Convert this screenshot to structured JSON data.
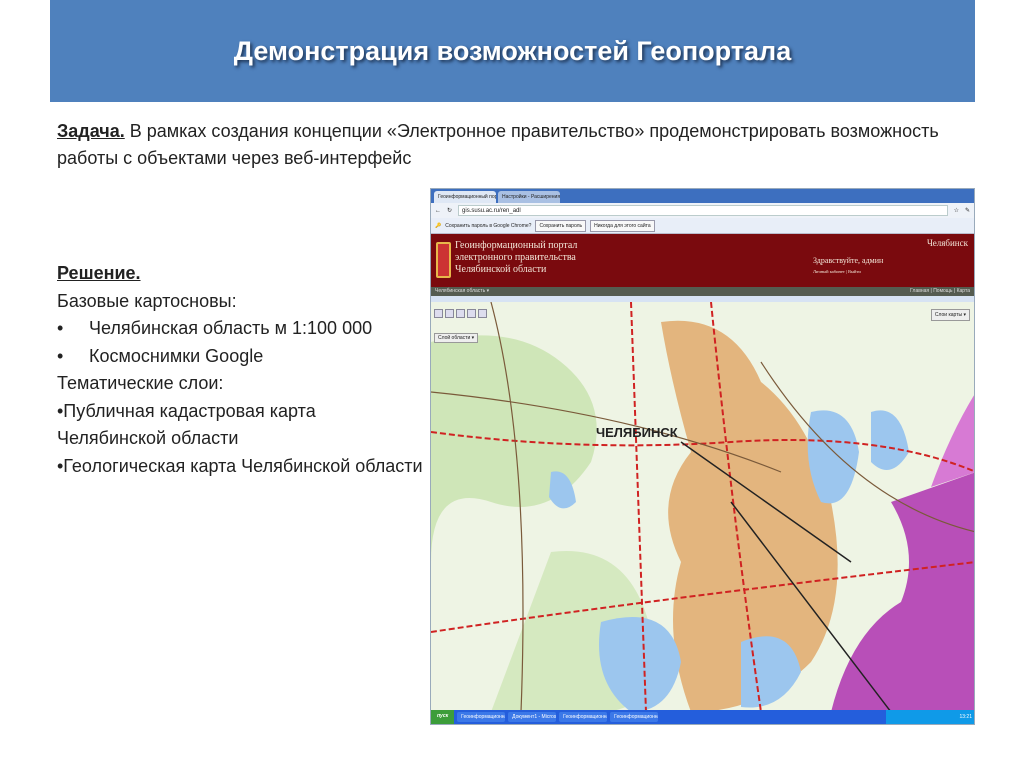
{
  "slide": {
    "title": "Демонстрация возможностей Геопортала",
    "task_label": "Задача.",
    "task_text": " В рамках создания концепции «Электронное правительство» продемонстрировать возможность работы с объектами через веб-интерфейс",
    "solution_label": "Решение.",
    "base_maps_label": "Базовые картосновы:",
    "base_maps": [
      "Челябинская область м 1:100 000",
      "Космоснимки Google"
    ],
    "bullet": "•",
    "thematic_label": "Тематические слои:",
    "thematic_layers": [
      "•Публичная кадастровая карта Челябинской области",
      "•Геологическая карта Челябинской области"
    ]
  },
  "browser": {
    "tabs": [
      "Геоинформационный портал",
      "Настройки - Расширения"
    ],
    "url": "gis.susu.ac.ru/ren_adl",
    "infobar": {
      "text": "Сохранить пароль в Google Chrome?",
      "save": "Сохранить пароль",
      "never": "Никогда для этого сайта"
    }
  },
  "portal": {
    "name_lines": [
      "Геоинформационный портал",
      "электронного правительства",
      "Челябинской области"
    ],
    "greeting": "Здравствуйте, админ",
    "cabinet": "Личный кабинет | Выйти",
    "city": "Челябинск",
    "region_select": "Челябинская область ▾",
    "main_links": "Главная | Помощь | Карта",
    "layer_select": "Слои карты ▾",
    "base_select": "Слой области ▾",
    "map_label": "ЧЕЛЯБИНСК"
  },
  "taskbar": {
    "start": "пуск",
    "items": [
      "Геоинформационна...",
      "Документ1 - Micros...",
      "Геоинформационна...",
      "Геоинформационна..."
    ],
    "clock": "13:21"
  }
}
